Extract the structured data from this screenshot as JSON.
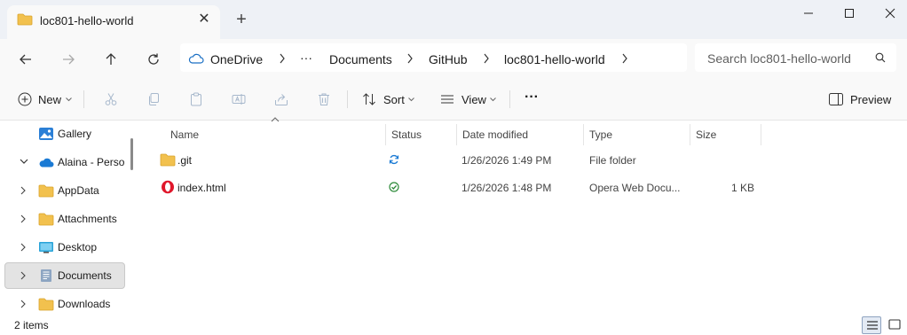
{
  "window": {
    "tab_title": "loc801-hello-world",
    "new_tab_symbol": "+",
    "close_tab_symbol": "✕"
  },
  "address": {
    "root": "OneDrive",
    "ellipsis": "···",
    "crumbs": [
      "Documents",
      "GitHub",
      "loc801-hello-world"
    ]
  },
  "search": {
    "placeholder": "Search loc801-hello-world"
  },
  "commands": {
    "new_label": "New",
    "sort_label": "Sort",
    "view_label": "View",
    "more_label": "···",
    "preview_label": "Preview"
  },
  "sidebar": {
    "items": [
      {
        "label": "Gallery",
        "icon": "gallery-icon"
      },
      {
        "label": "Alaina - Personal",
        "icon": "onedrive-icon"
      },
      {
        "label": "AppData",
        "icon": "folder-icon"
      },
      {
        "label": "Attachments",
        "icon": "folder-icon"
      },
      {
        "label": "Desktop",
        "icon": "desktop-icon"
      },
      {
        "label": "Documents",
        "icon": "documents-icon"
      },
      {
        "label": "Downloads",
        "icon": "folder-icon"
      }
    ]
  },
  "columns": {
    "name": "Name",
    "status": "Status",
    "date": "Date modified",
    "type": "Type",
    "size": "Size"
  },
  "files": [
    {
      "name": ".git",
      "status": "sync-pending-icon",
      "date": "1/26/2026 1:49 PM",
      "type": "File folder",
      "size": ""
    },
    {
      "name": "index.html",
      "status": "available-icon",
      "date": "1/26/2026 1:48 PM",
      "type": "Opera Web Docu...",
      "size": "1 KB"
    }
  ],
  "statusbar": {
    "item_count": "2 items"
  },
  "colors": {
    "folder": "#f2c14e",
    "accent": "#0067c0",
    "sync_blue": "#1a7ad4",
    "available_green": "#2e8b3a",
    "opera_red": "#e0172b"
  }
}
